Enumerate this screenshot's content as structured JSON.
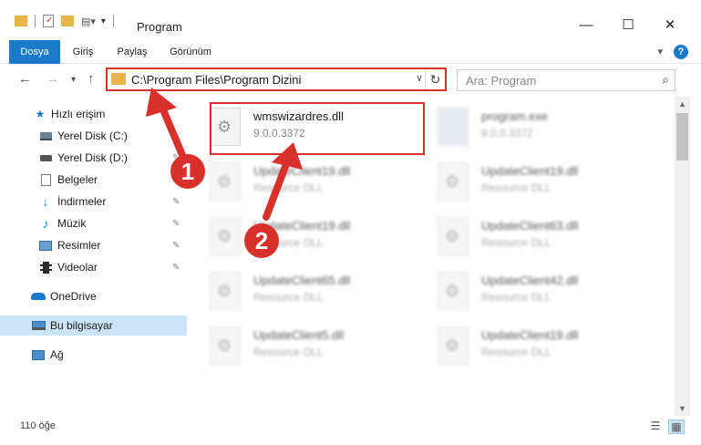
{
  "window": {
    "title": "Program",
    "buttons": {
      "minimize": "—",
      "maximize": "☐",
      "close": "✕"
    }
  },
  "ribbon": {
    "tabs": [
      {
        "label": "Dosya"
      },
      {
        "label": "Giriş"
      },
      {
        "label": "Paylaş"
      },
      {
        "label": "Görünüm"
      }
    ],
    "help_label": "?"
  },
  "address": {
    "path": "C:\\Program Files\\Program Dizini",
    "refresh_glyph": "↻"
  },
  "search": {
    "placeholder": "Ara: Program",
    "icon": "search-icon"
  },
  "sidebar": {
    "items": [
      {
        "label": "Hızlı erişim",
        "icon": "star-icon",
        "pinned": false
      },
      {
        "label": "Yerel Disk (C:)",
        "icon": "drive-icon",
        "pinned": true
      },
      {
        "label": "Yerel Disk (D:)",
        "icon": "drive-icon",
        "pinned": true
      },
      {
        "label": "Belgeler",
        "icon": "documents-icon",
        "pinned": true
      },
      {
        "label": "İndirmeler",
        "icon": "download-icon",
        "pinned": true
      },
      {
        "label": "Müzik",
        "icon": "music-icon",
        "pinned": true
      },
      {
        "label": "Resimler",
        "icon": "pictures-icon",
        "pinned": true
      },
      {
        "label": "Videolar",
        "icon": "video-icon",
        "pinned": true
      },
      {
        "label": "OneDrive",
        "icon": "cloud-icon",
        "pinned": false
      },
      {
        "label": "Bu bilgisayar",
        "icon": "computer-icon",
        "pinned": false
      },
      {
        "label": "Ağ",
        "icon": "network-icon",
        "pinned": false
      }
    ]
  },
  "files": [
    {
      "name": "wmswizardres.dll",
      "sub": "9.0.0.3372"
    },
    {
      "name": "program.exe",
      "sub": "9.0.0.3372"
    },
    {
      "name": "UpdateClient19.dll",
      "sub": "Resource DLL"
    },
    {
      "name": "UpdateClient19.dll",
      "sub": "Resource DLL"
    },
    {
      "name": "UpdateClient19.dll",
      "sub": "Resource DLL"
    },
    {
      "name": "UpdateClient63.dll",
      "sub": "Resource DLL"
    },
    {
      "name": "UpdateClient65.dll",
      "sub": "Resource DLL"
    },
    {
      "name": "UpdateClient42.dll",
      "sub": "Resource DLL"
    },
    {
      "name": "UpdateClient5.dll",
      "sub": "Resource DLL"
    },
    {
      "name": "UpdateClient19.dll",
      "sub": "Resource DLL"
    }
  ],
  "status": {
    "item_count": "110 öğe"
  },
  "annotations": {
    "step1": "1",
    "step2": "2",
    "color": "#d9302c"
  }
}
